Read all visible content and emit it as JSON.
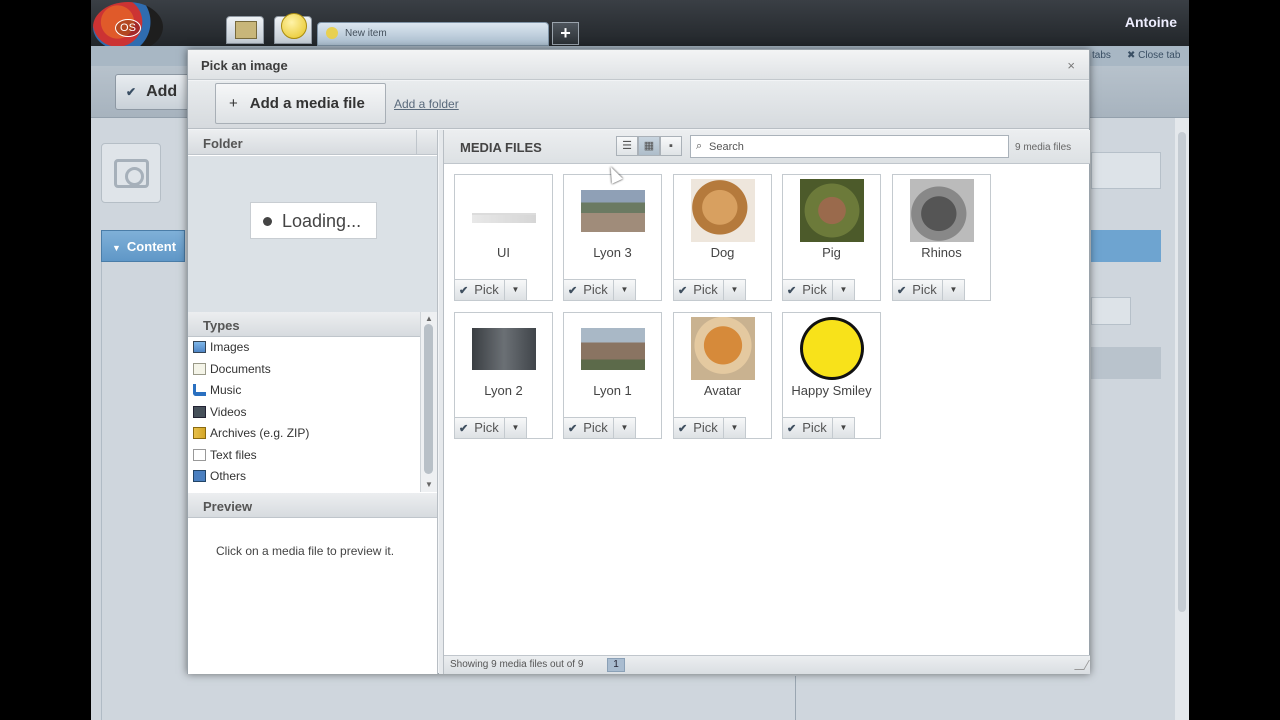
{
  "app": {
    "user": "Antoine",
    "new_tab": "New item",
    "add_tab": "+"
  },
  "background": {
    "add_button": "Add",
    "content_header": "Content",
    "tabs_link": "tabs",
    "close_tab_link": "✖ Close tab"
  },
  "dialog": {
    "title": "Pick an image",
    "close": "×",
    "add_media_button": "Add a media file",
    "add_folder_link": "Add a folder",
    "folder_header": "Folder",
    "loading": "Loading...",
    "types_header": "Types",
    "types": [
      {
        "label": "Images",
        "icon": "images-icon"
      },
      {
        "label": "Documents",
        "icon": "documents-icon"
      },
      {
        "label": "Music",
        "icon": "music-icon"
      },
      {
        "label": "Videos",
        "icon": "videos-icon"
      },
      {
        "label": "Archives (e.g. ZIP)",
        "icon": "archives-icon"
      },
      {
        "label": "Text files",
        "icon": "text-files-icon"
      },
      {
        "label": "Others",
        "icon": "others-icon"
      }
    ],
    "preview_header": "Preview",
    "preview_hint": "Click on a media file to preview it.",
    "media_header": "MEDIA FILES",
    "search_placeholder": "Search",
    "media_count": "9 media files",
    "pick_label": "Pick",
    "media": [
      {
        "name": "UI"
      },
      {
        "name": "Lyon 3"
      },
      {
        "name": "Dog"
      },
      {
        "name": "Pig"
      },
      {
        "name": "Rhinos"
      },
      {
        "name": "Lyon 2"
      },
      {
        "name": "Lyon 1"
      },
      {
        "name": "Avatar"
      },
      {
        "name": "Happy Smiley"
      }
    ],
    "status": "Showing 9 media files out of 9",
    "page": "1"
  }
}
